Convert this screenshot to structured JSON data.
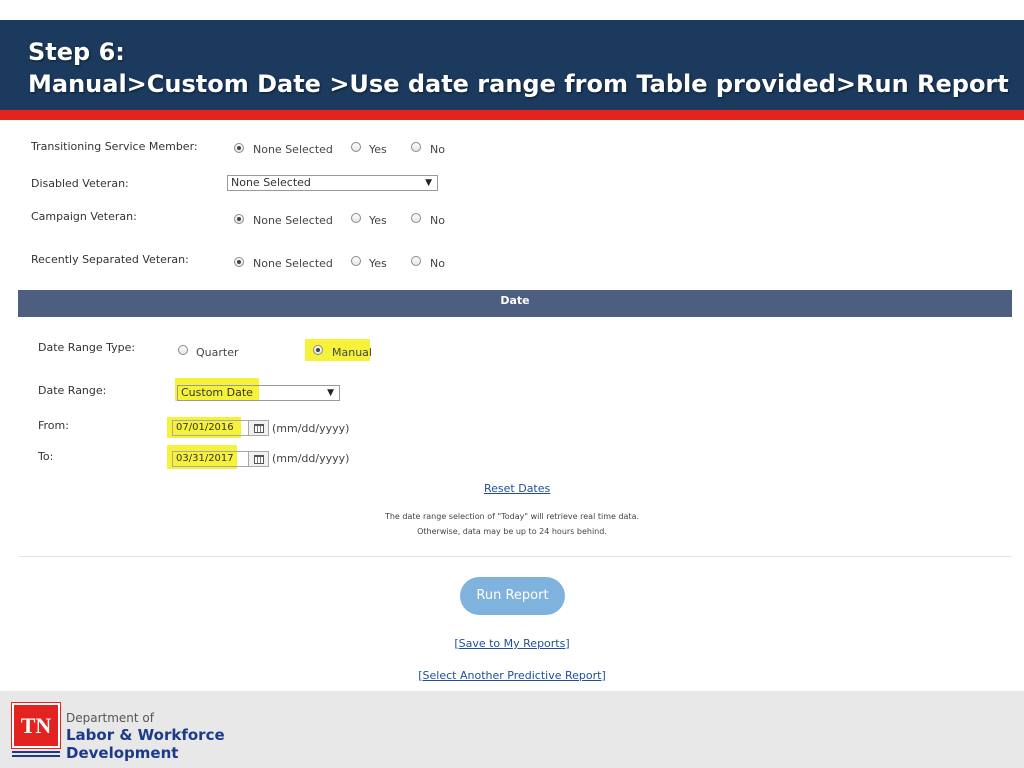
{
  "header": {
    "line1": "Step 6:",
    "line2": "Manual>Custom Date >Use date range from Table provided>Run Report",
    "bg_color": "#1b3a5e",
    "accent_color": "#e3231f"
  },
  "filters": {
    "transitioning": {
      "label": "Transitioning Service Member:",
      "options": [
        "None Selected",
        "Yes",
        "No"
      ],
      "selected": "None Selected"
    },
    "disabled": {
      "label": "Disabled Veteran:",
      "value": "None Selected"
    },
    "campaign": {
      "label": "Campaign Veteran:",
      "options": [
        "None Selected",
        "Yes",
        "No"
      ],
      "selected": "None Selected"
    },
    "recent": {
      "label": "Recently Separated Veteran:",
      "options": [
        "None Selected",
        "Yes",
        "No"
      ],
      "selected": "None Selected"
    }
  },
  "date_section": {
    "title": "Date",
    "range_type": {
      "label": "Date Range Type:",
      "options": [
        "Quarter",
        "Manual"
      ],
      "selected": "Manual"
    },
    "range": {
      "label": "Date Range:",
      "value": "Custom Date"
    },
    "from": {
      "label": "From:",
      "value": "07/01/2016",
      "format": "(mm/dd/yyyy)"
    },
    "to": {
      "label": "To:",
      "value": "03/31/2017",
      "format": "(mm/dd/yyyy)"
    },
    "reset_label": "Reset Dates",
    "note_line1": "The date range selection of \"Today\" will retrieve real time data.",
    "note_line2": "Otherwise, data may be up to 24 hours behind."
  },
  "actions": {
    "run_label": "Run Report",
    "save_label": "Save to My Reports",
    "select_label": "Select Another Predictive Report"
  },
  "footer": {
    "logo_text": "TN",
    "dept_line1": "Department of",
    "dept_line2": "Labor & Workforce",
    "dept_line3": "Development"
  }
}
